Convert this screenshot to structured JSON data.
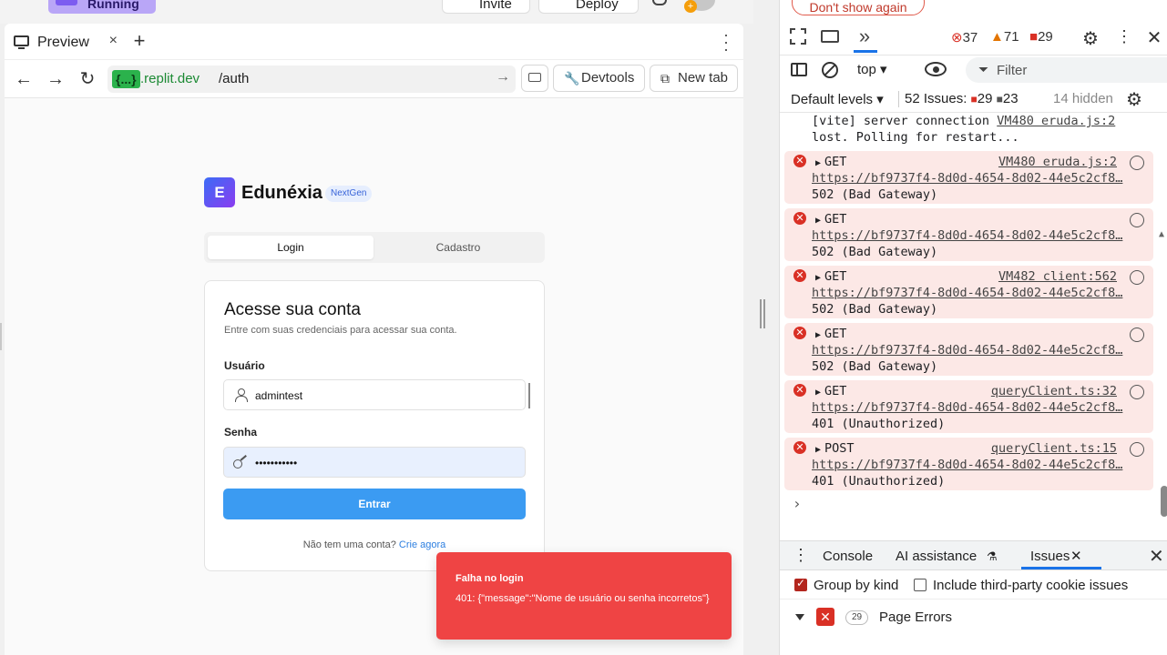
{
  "app": {
    "run_label": "Running",
    "invite_label": "Invite",
    "deploy_label": "Deploy"
  },
  "preview": {
    "tab_label": "Preview",
    "tab_close": "×",
    "new_tab_symbol": "+",
    "url_badge": "{...}",
    "url_domain": ".replit.dev",
    "url_path": "/auth",
    "devtools_label": "Devtools",
    "newtab_label": "New tab"
  },
  "login": {
    "brand_initial": "E",
    "brand_name": "Edunéxia",
    "brand_badge": "NextGen",
    "tabs": [
      "Login",
      "Cadastro"
    ],
    "title": "Acesse sua conta",
    "subtitle": "Entre com suas credenciais para acessar sua conta.",
    "username_label": "Usuário",
    "username_value": "admintest",
    "password_label": "Senha",
    "password_value": "•••••••••••",
    "submit_label": "Entrar",
    "signup_prompt": "Não tem uma conta?",
    "signup_link": "Crie agora"
  },
  "toast": {
    "title": "Falha no login",
    "message": "401: {\"message\":\"Nome de usuário ou senha incorretos\"}"
  },
  "devtools": {
    "dont_show_label": "Don't show again",
    "error_count": "37",
    "warning_count": "71",
    "message_count": "29",
    "context": "top ▾",
    "filter_placeholder": "Filter",
    "levels": "Default levels ▾",
    "issues_label": "52 Issues:",
    "issues_err": "29",
    "issues_warn": "23",
    "hidden": "14 hidden",
    "plain_log": {
      "text1": "[vite] server connection",
      "source": "VM480 eruda.js:2",
      "text2": "lost. Polling for restart..."
    },
    "entries": [
      {
        "method": "GET",
        "source": "VM480 eruda.js:2",
        "url": "https://bf9737f4-8d0d-4654-8d02-44e5c2cf8…",
        "status": "502 (Bad Gateway)"
      },
      {
        "method": "GET",
        "source": "",
        "url": "https://bf9737f4-8d0d-4654-8d02-44e5c2cf8…",
        "status": "502 (Bad Gateway)"
      },
      {
        "method": "GET",
        "source": "VM482 client:562",
        "url": "https://bf9737f4-8d0d-4654-8d02-44e5c2cf8…",
        "status": "502 (Bad Gateway)"
      },
      {
        "method": "GET",
        "source": "",
        "url": "https://bf9737f4-8d0d-4654-8d02-44e5c2cf8…",
        "status": "502 (Bad Gateway)"
      },
      {
        "method": "GET",
        "source": "queryClient.ts:32",
        "url": "https://bf9737f4-8d0d-4654-8d02-44e5c2cf8…",
        "status": "401 (Unauthorized)"
      },
      {
        "method": "POST",
        "source": "queryClient.ts:15",
        "url": "https://bf9737f4-8d0d-4654-8d02-44e5c2cf8…",
        "status": "401 (Unauthorized)"
      }
    ],
    "drawer_tabs": [
      "Console",
      "AI assistance",
      "Issues"
    ],
    "group_by_kind": "Group by kind",
    "third_party": "Include third-party cookie issues",
    "page_errors_count": "29",
    "page_errors_label": "Page Errors"
  }
}
